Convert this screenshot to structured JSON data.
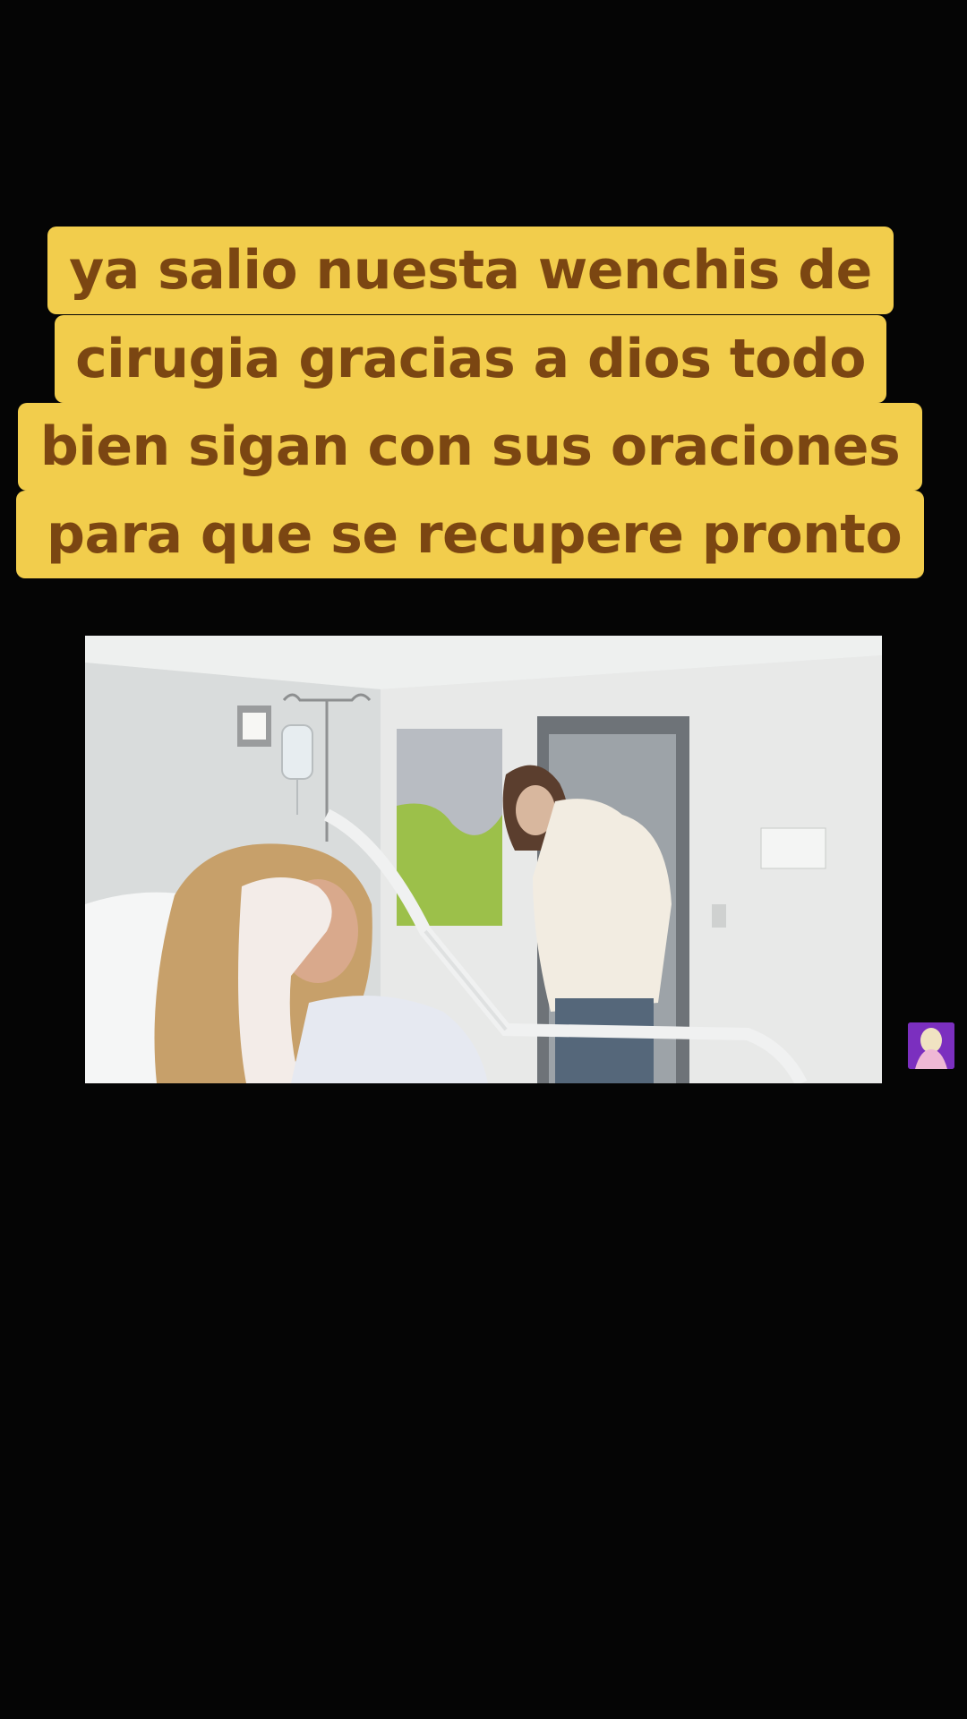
{
  "caption": {
    "lines": [
      "ya salio nuesta wenchis de",
      "cirugia gracias a dios todo",
      "bien sigan con sus oraciones",
      "para que se recupere pronto"
    ]
  },
  "colors": {
    "background": "#050505",
    "caption_bg": "#f2cd4c",
    "caption_text": "#7b4612",
    "avatar_bg": "#7b2fbf"
  },
  "icons": [
    "creator-avatar-icon"
  ]
}
